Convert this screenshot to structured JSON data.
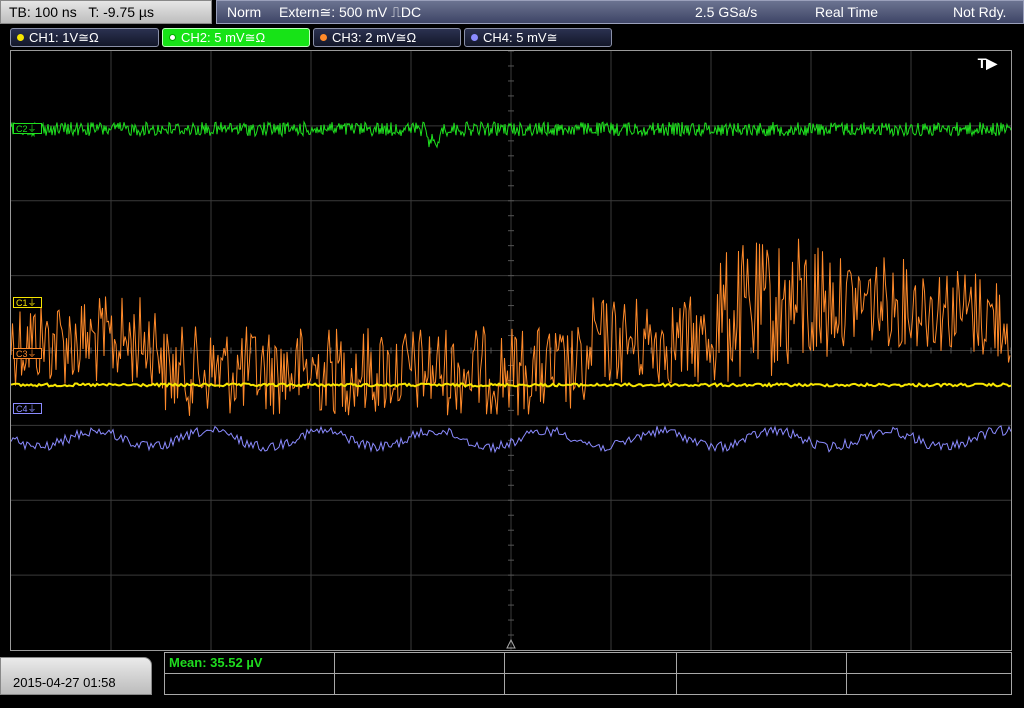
{
  "status": {
    "timebase": "TB: 100 ns",
    "trigger_time": "T: -9.75 µs",
    "mode": "Norm",
    "trigger_source": "Extern≅: 500 mV ⎍DC",
    "sample_rate": "2.5 GSa/s",
    "acquisition": "Real Time",
    "ready_state": "Not Rdy."
  },
  "channels": [
    {
      "label": "CH1: 1V≅Ω",
      "color": "#f7e600",
      "short": "C1⏚",
      "active": false
    },
    {
      "label": "CH2: 5 mV≅Ω",
      "color": "#1fe01f",
      "short": "C2⏚",
      "active": true
    },
    {
      "label": "CH3: 2 mV≅Ω",
      "color": "#ff8a2a",
      "short": "C3⏚",
      "active": false
    },
    {
      "label": "CH4: 5 mV≅",
      "color": "#8b8bff",
      "short": "C4⏚",
      "active": false
    }
  ],
  "trigger_marker": "T▶",
  "datetime": "2015-04-27 01:58",
  "measurement": {
    "mean": "Mean: 35.52 µV"
  }
}
